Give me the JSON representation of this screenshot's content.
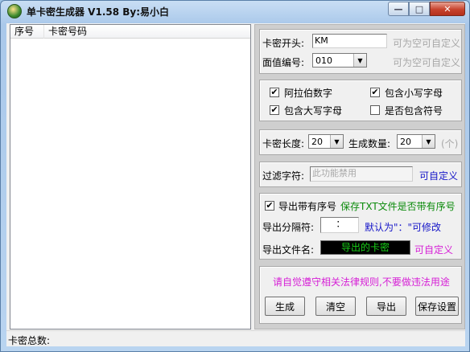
{
  "window": {
    "title": "单卡密生成器 V1.58 By:易小白",
    "min_glyph": "—",
    "max_glyph": "□",
    "close_glyph": "✕"
  },
  "list": {
    "columns": [
      "序号",
      "卡密号码"
    ],
    "rows": []
  },
  "status": {
    "total_label": "卡密总数:"
  },
  "prefix": {
    "label": "卡密开头:",
    "value": "KM",
    "hint": "可为空可自定义"
  },
  "face_value": {
    "label": "面值编号:",
    "value": "010",
    "hint": "可为空可自定义"
  },
  "charsets": {
    "digits": {
      "label": "阿拉伯数字",
      "checked": true
    },
    "lowercase": {
      "label": "包含小写字母",
      "checked": true
    },
    "uppercase": {
      "label": "包含大写字母",
      "checked": true
    },
    "symbols": {
      "label": "是否包含符号",
      "checked": false
    }
  },
  "length": {
    "label": "卡密长度:",
    "value": "20",
    "count_label": "生成数量:",
    "count_value": "20",
    "unit": "(个)"
  },
  "filter": {
    "label": "过滤字符:",
    "placeholder": "此功能禁用",
    "hint": "可自定义"
  },
  "export": {
    "with_index_label": "导出带有序号",
    "with_index_checked": true,
    "with_index_hint": "保存TXT文件是否带有序号",
    "separator_label": "导出分隔符:",
    "separator_value": "：",
    "separator_hint": "默认为\"：\"可修改",
    "filename_label": "导出文件名:",
    "filename_value": "导出的卡密",
    "filename_hint": "可自定义"
  },
  "notice": "请自觉遵守相关法律规则,不要做违法用途",
  "buttons": {
    "generate": "生成",
    "clear": "清空",
    "export": "导出",
    "save_settings": "保存设置"
  },
  "colors": {
    "hint_gray": "#a8a8a8",
    "blue_text": "#1515c8",
    "green_text": "#0a8a0a",
    "magenta_text": "#d61fd6",
    "filename_bg": "#000000",
    "filename_fg": "#18d218"
  }
}
